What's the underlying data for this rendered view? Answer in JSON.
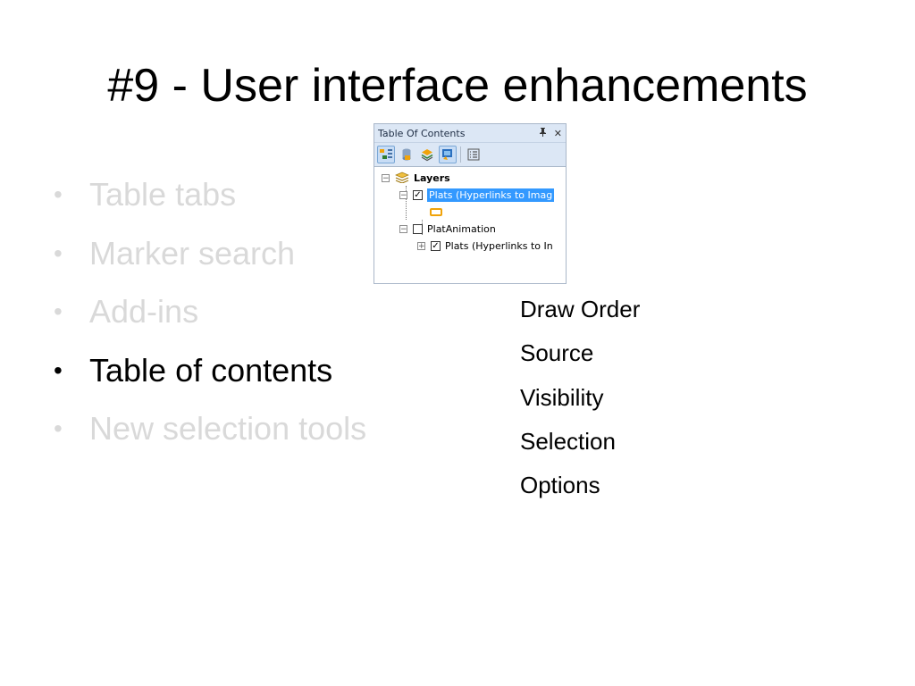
{
  "slide": {
    "title": "#9 - User interface enhancements",
    "bullets": [
      {
        "label": "Table tabs",
        "active": false
      },
      {
        "label": "Marker search",
        "active": false
      },
      {
        "label": "Add-ins",
        "active": false
      },
      {
        "label": "Table of contents",
        "active": true
      },
      {
        "label": "New selection tools",
        "active": false
      }
    ],
    "bullet_symbol": "•",
    "features": [
      "Draw Order",
      "Source",
      "Visibility",
      "Selection",
      "Options"
    ]
  },
  "toc": {
    "title": "Table Of Contents",
    "pin_glyph": "p",
    "close_glyph": "✕",
    "toolbar": [
      {
        "name": "list-by-drawing-order-icon",
        "glyph": "⚡",
        "pressed": true
      },
      {
        "name": "list-by-source-icon",
        "glyph": "🛢",
        "pressed": false
      },
      {
        "name": "list-by-visibility-icon",
        "glyph": "◈",
        "pressed": false
      },
      {
        "name": "list-by-selection-icon",
        "glyph": "▣",
        "pressed": true
      },
      {
        "name": "options-icon",
        "glyph": "☰",
        "pressed": false
      }
    ],
    "tree": {
      "root_label": "Layers",
      "layer1_label": "Plats (Hyperlinks to Imag",
      "group_label": "PlatAnimation",
      "group_child_label": "Plats (Hyperlinks to In",
      "expand_minus": "−",
      "expand_plus": "+",
      "check": "✓"
    },
    "colors": {
      "selection_highlight": "#3399ff",
      "symbol_outline": "#f0a30a",
      "panel_header": "#dce7f5"
    }
  }
}
